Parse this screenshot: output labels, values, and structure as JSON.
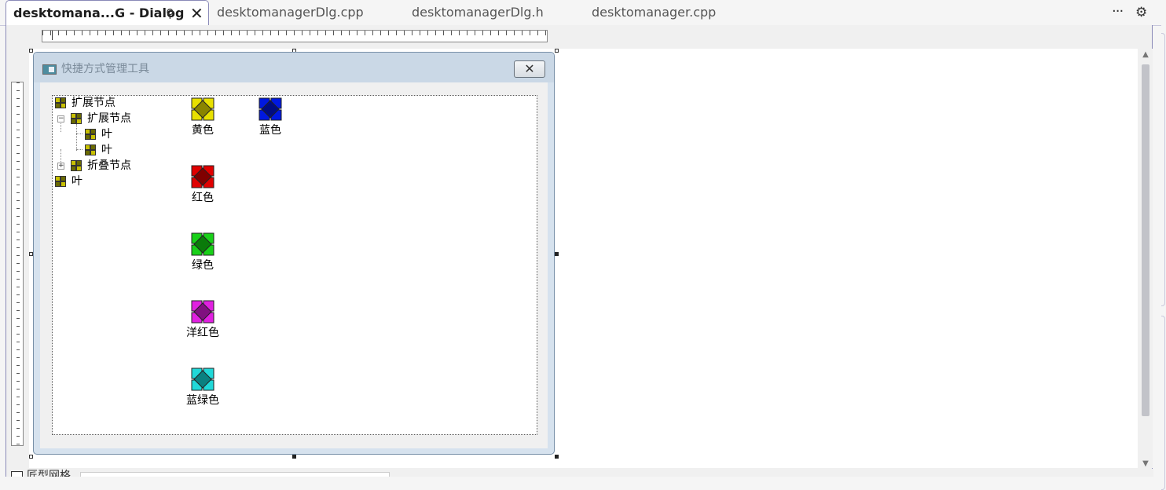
{
  "tabs": [
    {
      "label": "desktomana...G - Dialog",
      "active": true
    },
    {
      "label": "desktomanagerDlg.cpp",
      "active": false
    },
    {
      "label": "desktomanagerDlg.h",
      "active": false
    },
    {
      "label": "desktomanager.cpp",
      "active": false
    }
  ],
  "tab_icons": {
    "pin": "pin-icon",
    "close": "close-icon",
    "more": "more-options-icon",
    "settings": "gear-icon"
  },
  "dialog": {
    "title": "快捷方式管理工具",
    "close_glyph": "✕",
    "tree": [
      {
        "label": "扩展节点",
        "level": 0,
        "expander": "none",
        "icon_color": "#c8c000"
      },
      {
        "label": "扩展节点",
        "level": 1,
        "expander": "minus",
        "icon_color": "#c8c000"
      },
      {
        "label": "叶",
        "level": 2,
        "expander": "none",
        "icon_color": "#c8c000"
      },
      {
        "label": "叶",
        "level": 2,
        "expander": "none",
        "icon_color": "#c8c000"
      },
      {
        "label": "折叠节点",
        "level": 1,
        "expander": "plus",
        "icon_color": "#c8c000"
      },
      {
        "label": "叶",
        "level": 0,
        "expander": "none",
        "icon_color": "#c8c000"
      }
    ],
    "list_items": [
      {
        "label": "黄色",
        "color": "#e8e000",
        "dark": "#8a8400"
      },
      {
        "label": "蓝色",
        "color": "#0018e0",
        "dark": "#000c80"
      },
      {
        "label": "红色",
        "color": "#e00000",
        "dark": "#800000"
      },
      {
        "label": "绿色",
        "color": "#18d018",
        "dark": "#0a7a0a"
      },
      {
        "label": "洋红色",
        "color": "#e020e0",
        "dark": "#801080"
      },
      {
        "label": "蓝绿色",
        "color": "#20d8d8",
        "dark": "#0a8080"
      }
    ]
  },
  "bottom": {
    "checkbox_label": "匠型网格"
  }
}
